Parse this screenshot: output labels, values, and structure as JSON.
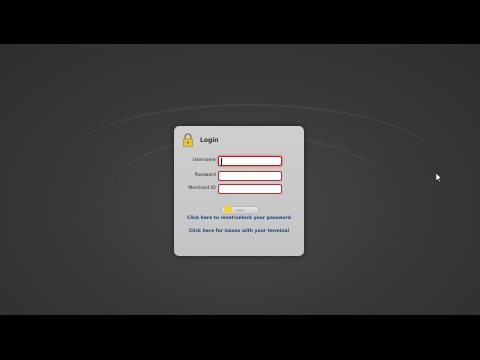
{
  "window": {
    "title": "Login"
  },
  "form": {
    "username_label": "Username",
    "password_label": "Password",
    "merchant_label": "Merchant ID",
    "required_mark": "*",
    "username_value": "",
    "password_value": "",
    "merchant_value": "",
    "login_button": "Login"
  },
  "links": {
    "reset_password": "Click here to reset/unlock your password",
    "terminal_issues": "Click here for issues with your terminal"
  },
  "colors": {
    "link": "#1f3f7a",
    "required": "#cc0000",
    "panel": "#c8c8c8",
    "lock": "#e8c23a"
  },
  "icons": [
    "lock-icon",
    "mouse-cursor-icon"
  ]
}
